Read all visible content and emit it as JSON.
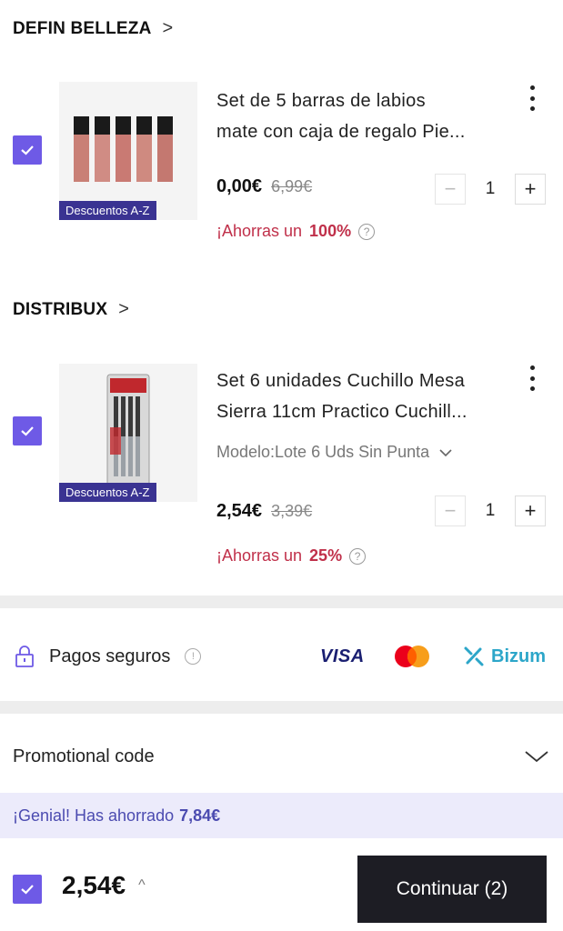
{
  "sellers": [
    {
      "name": "DEFIN BELLEZA",
      "product": {
        "title_line1": "Set de 5 barras de labios",
        "title_line2": "mate con caja de regalo Pie...",
        "tag": "Descuentos A-Z",
        "price": "0,00€",
        "old_price": "6,99€",
        "quantity": "1",
        "savings_prefix": "¡Ahorras un",
        "savings_pct": "100%"
      }
    },
    {
      "name": "DISTRIBUX",
      "product": {
        "title_line1": "Set 6 unidades Cuchillo Mesa",
        "title_line2": "Sierra 11cm Practico Cuchill...",
        "variant": "Modelo:Lote 6 Uds Sin Punta",
        "tag": "Descuentos A-Z",
        "price": "2,54€",
        "old_price": "3,39€",
        "quantity": "1",
        "savings_prefix": "¡Ahorras un",
        "savings_pct": "25%"
      }
    }
  ],
  "payments": {
    "label": "Pagos seguros",
    "methods": [
      "VISA",
      "mastercard",
      "Bizum"
    ],
    "visa_text": "VISA",
    "bizum_text": "Bizum"
  },
  "promo": {
    "label": "Promotional code"
  },
  "savings_bar": {
    "prefix": "¡Genial! Has ahorrado",
    "amount": "7,84€"
  },
  "footer": {
    "total": "2,54€",
    "continue_label": "Continuar (2)"
  },
  "colors": {
    "accent": "#6e5ae6",
    "savings_red": "#c0304a",
    "button_dark": "#1d1d24"
  }
}
